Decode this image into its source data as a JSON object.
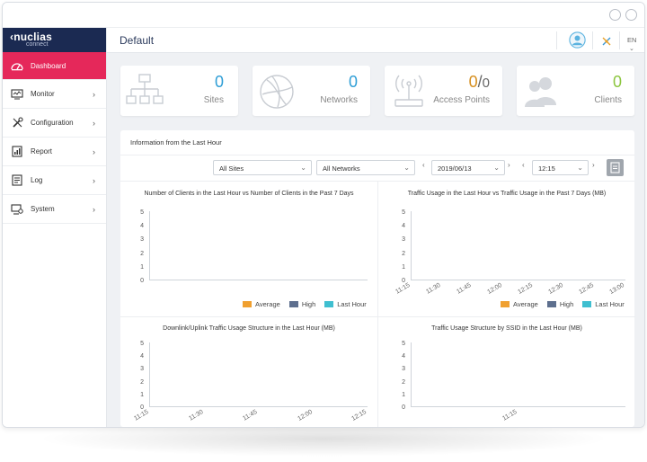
{
  "app": {
    "logo_name": "nuclias",
    "logo_sub": "connect",
    "page_title": "Default",
    "language": "EN"
  },
  "colors": {
    "accent": "#e5285a",
    "brand": "#1b2a52",
    "number": "#2f9ed6",
    "ap_online": "#d68f1f",
    "clients": "#8cc63f",
    "average": "#f0a030",
    "high": "#5d6f8e",
    "last_hour": "#3fbfd0"
  },
  "sidebar": {
    "items": [
      {
        "label": "Dashboard",
        "icon": "dashboard-icon",
        "active": true
      },
      {
        "label": "Monitor",
        "icon": "monitor-icon"
      },
      {
        "label": "Configuration",
        "icon": "wrench-icon"
      },
      {
        "label": "Report",
        "icon": "report-icon"
      },
      {
        "label": "Log",
        "icon": "log-icon"
      },
      {
        "label": "System",
        "icon": "system-icon"
      }
    ]
  },
  "stats": {
    "sites": {
      "value": "0",
      "label": "Sites"
    },
    "networks": {
      "value": "0",
      "label": "Networks"
    },
    "access_points": {
      "online": "0",
      "slash": "/",
      "total": "0",
      "label": "Access Points"
    },
    "clients": {
      "value": "0",
      "label": "Clients"
    }
  },
  "panel": {
    "title": "Information from the Last Hour",
    "filters": {
      "site": "All Sites",
      "network": "All Networks",
      "date": "2019/06/13",
      "time": "12:15"
    }
  },
  "charts": {
    "clients": {
      "title": "Number of Clients in the Last Hour vs Number of Clients in the Past 7 Days",
      "y_ticks": [
        "5",
        "4",
        "3",
        "2",
        "1",
        "0"
      ],
      "legend": [
        "Average",
        "High",
        "Last Hour"
      ]
    },
    "traffic": {
      "title": "Traffic Usage in the Last Hour vs Traffic Usage in the Past 7 Days (MB)",
      "y_ticks": [
        "5",
        "4",
        "3",
        "2",
        "1",
        "0"
      ],
      "x_ticks": [
        "11:15",
        "11:30",
        "11:45",
        "12:00",
        "12:15",
        "12:30",
        "12:45",
        "13:00"
      ],
      "legend": [
        "Average",
        "High",
        "Last Hour"
      ]
    },
    "downlink": {
      "title": "Downlink/Uplink Traffic Usage Structure in the Last Hour (MB)",
      "y_ticks": [
        "5",
        "4",
        "3",
        "2",
        "1",
        "0"
      ],
      "x_ticks": [
        "11:15",
        "11:30",
        "11:45",
        "12:00",
        "12:15"
      ]
    },
    "ssid": {
      "title": "Traffic Usage Structure by SSID in the Last Hour (MB)",
      "y_ticks": [
        "5",
        "4",
        "3",
        "2",
        "1",
        "0"
      ],
      "x_ticks": [
        "11:15"
      ]
    }
  }
}
